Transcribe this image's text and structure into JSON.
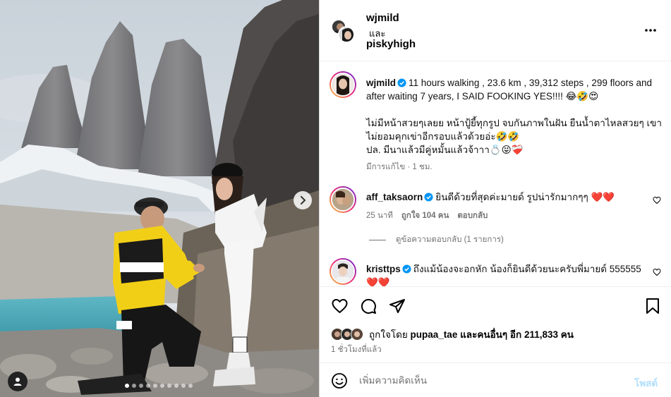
{
  "header": {
    "user1": "wjmild",
    "connector": "และ",
    "user2": "piskyhigh"
  },
  "caption": {
    "username": "wjmild",
    "line1": "11 hours walking , 23.6 km , 39,312 steps , 299 floors and after waiting 7 years, I SAID FOOKING YES!!!! 😂🤣😍",
    "line2": "ไม่มีหน้าสวยๆเลยย หน้าปู้ยี้ทุกรูป จบกันภาพในฝัน ยืนน้ำตาไหลสวยๆ เขาไม่ยอมคุกเข่าอีกรอบแล้วด้วยอ่ะ🤣🤣",
    "line3": "ปล. มีนาแล้วมีคู่หมั้นแล้วจ้าาา💍😝❤️‍🩹",
    "meta": "มีการแก้ไข · 1 ชม."
  },
  "comments": [
    {
      "username": "aff_taksaorn",
      "text": "ยินดีด้วยที่สุดค่ะมายด์ รูปน่ารักมากๆๆ ❤️❤️",
      "time": "25 นาที",
      "likes": "ถูกใจ 104 คน",
      "reply": "ตอบกลับ"
    },
    {
      "username": "kristtps",
      "text": "ถึงแม้น้องจะอกหัก น้องก็ยินดีด้วยนะครับพี่มายด์ 555555 ❤️❤️"
    }
  ],
  "view_replies": "ดูข้อความตอบกลับ (1 รายการ)",
  "likes": {
    "prefix": "ถูกใจโดย",
    "user": "pupaa_tae",
    "suffix": "และคนอื่นๆ อีก 211,833 คน"
  },
  "post_time": "1 ชั่วโมงที่แล้ว",
  "comment_box": {
    "placeholder": "เพิ่มความคิดเห็น",
    "post_label": "โพสต์"
  },
  "carousel": {
    "count": 10,
    "active": 0
  },
  "colors": {
    "verified": "#0095f6",
    "heart": "#ff3040",
    "post_disabled": "#b2dffc",
    "meta_gray": "#737373"
  },
  "icons": [
    "heart-icon",
    "comment-icon",
    "share-icon",
    "bookmark-icon",
    "more-icon",
    "emoji-icon",
    "user-tag-icon",
    "chevron-right-icon",
    "verified-badge-icon"
  ]
}
